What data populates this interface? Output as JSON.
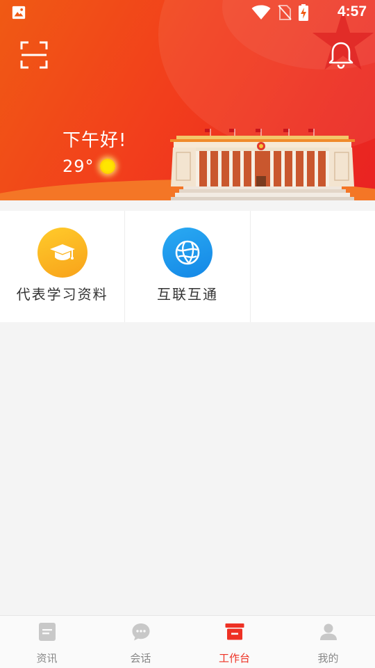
{
  "status_bar": {
    "time": "4:57",
    "icons": [
      "gallery-icon",
      "wifi-icon",
      "no-sim-icon",
      "battery-charging-icon"
    ]
  },
  "header": {
    "greeting": "下午好!",
    "temperature": "29°",
    "weather_icon": "sun-icon",
    "left_icon": "scan-icon",
    "right_icon": "bell-icon",
    "colors": {
      "banner_start": "#f05a14",
      "banner_end": "#e92222"
    }
  },
  "tools": [
    {
      "label": "代表学习资料",
      "icon": "graduation-cap-icon",
      "color": "#f8a21a"
    },
    {
      "label": "互联互通",
      "icon": "globe-network-icon",
      "color": "#1487e6"
    }
  ],
  "tabbar": {
    "items": [
      {
        "label": "资讯",
        "icon": "news-icon",
        "active": false
      },
      {
        "label": "会话",
        "icon": "chat-icon",
        "active": false
      },
      {
        "label": "工作台",
        "icon": "workbench-icon",
        "active": true
      },
      {
        "label": "我的",
        "icon": "user-icon",
        "active": false
      }
    ],
    "active_color": "#ee3124",
    "inactive_color": "#888888"
  }
}
